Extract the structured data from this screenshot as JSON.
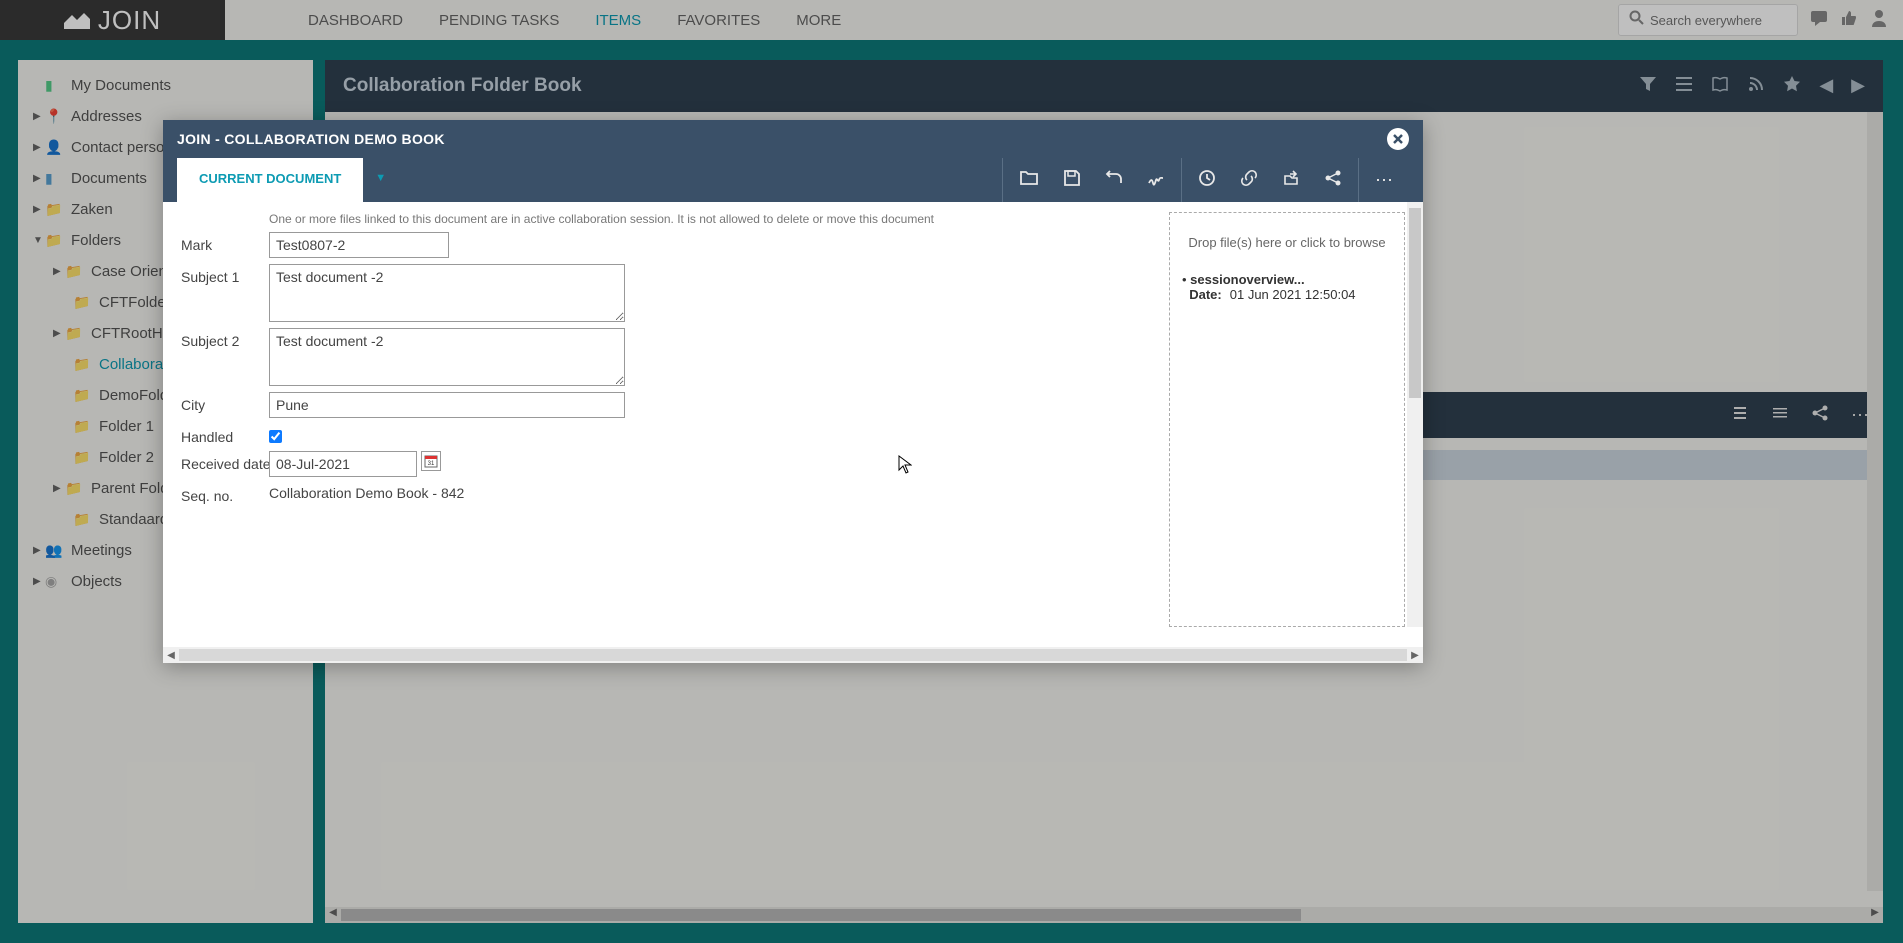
{
  "header": {
    "logo": "JOIN",
    "nav": {
      "dashboard": "DASHBOARD",
      "pending": "PENDING TASKS",
      "items": "ITEMS",
      "favorites": "FAVORITES",
      "more": "MORE"
    },
    "search_placeholder": "Search everywhere"
  },
  "sidebar": {
    "items": [
      {
        "label": "My Documents"
      },
      {
        "label": "Addresses"
      },
      {
        "label": "Contact persons"
      },
      {
        "label": "Documents"
      },
      {
        "label": "Zaken"
      },
      {
        "label": "Folders"
      },
      {
        "label": "Case Oriente"
      },
      {
        "label": "CFTFolder"
      },
      {
        "label": "CFTRootHBoo"
      },
      {
        "label": "Collaboration"
      },
      {
        "label": "DemoFolderE"
      },
      {
        "label": "Folder 1"
      },
      {
        "label": "Folder 2"
      },
      {
        "label": "Parent Folder"
      },
      {
        "label": "Standaard do"
      },
      {
        "label": "Meetings"
      },
      {
        "label": "Objects"
      }
    ]
  },
  "content": {
    "title": "Collaboration Folder Book"
  },
  "modal": {
    "title": "JOIN - COLLABORATION DEMO BOOK",
    "tab_label": "CURRENT DOCUMENT",
    "warning": "One or more files linked to this document are in active collaboration session. It is not allowed to delete or move this document",
    "labels": {
      "mark": "Mark",
      "subject1": "Subject 1",
      "subject2": "Subject 2",
      "city": "City",
      "handled": "Handled",
      "received": "Received date",
      "seq": "Seq. no."
    },
    "values": {
      "mark": "Test0807-2",
      "subject1": "Test document -2",
      "subject2": "Test document -2",
      "city": "Pune",
      "handled": true,
      "received": "08-Jul-2021",
      "seq": "Collaboration Demo Book - 842"
    },
    "drop": {
      "text": "Drop file(s) here or click to browse",
      "file_name": "sessionoverview...",
      "date_label": "Date:",
      "date_value": "01 Jun 2021 12:50:04"
    }
  }
}
